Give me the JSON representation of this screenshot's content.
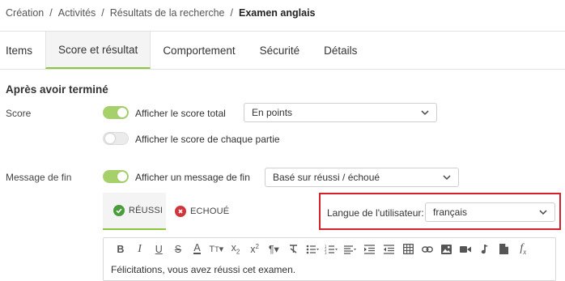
{
  "breadcrumb": [
    "Création",
    "Activités",
    "Résultats de la recherche",
    "Examen anglais"
  ],
  "tabs": [
    "Items",
    "Score et résultat",
    "Comportement",
    "Sécurité",
    "Détails"
  ],
  "section_title": "Après avoir terminé",
  "score": {
    "label": "Score",
    "toggle_total": "Afficher le score total",
    "toggle_total_on": true,
    "score_select": "En points",
    "toggle_parts": "Afficher le score de chaque partie",
    "toggle_parts_on": false
  },
  "end_message": {
    "label": "Message de fin",
    "toggle": "Afficher un message de fin",
    "toggle_on": true,
    "select": "Basé sur réussi / échoué",
    "tab_pass": "RÉUSSI",
    "tab_fail": "ECHOUÉ",
    "language_label": "Langue de l'utilisateur:",
    "language_select": "français",
    "content": "Félicitations, vous avez réussi cet examen."
  },
  "toolbar_items": [
    "bold-icon",
    "italic-icon",
    "underline-icon",
    "strikethrough-icon",
    "font-color-icon",
    "font-size-icon",
    "subscript-icon",
    "superscript-icon",
    "paragraph-format-icon",
    "clear-format-icon",
    "bulleted-list-icon",
    "numbered-list-icon",
    "align-icon",
    "indent-icon",
    "outdent-icon",
    "table-icon",
    "link-icon",
    "image-icon",
    "video-icon",
    "audio-icon",
    "file-icon",
    "formula-icon"
  ],
  "colors": {
    "accent_green": "#8cc63f",
    "toggle_on": "#a6d16a",
    "highlight_red": "#d6202a",
    "pass_icon": "#4a9d3a",
    "fail_icon": "#d0353c"
  }
}
